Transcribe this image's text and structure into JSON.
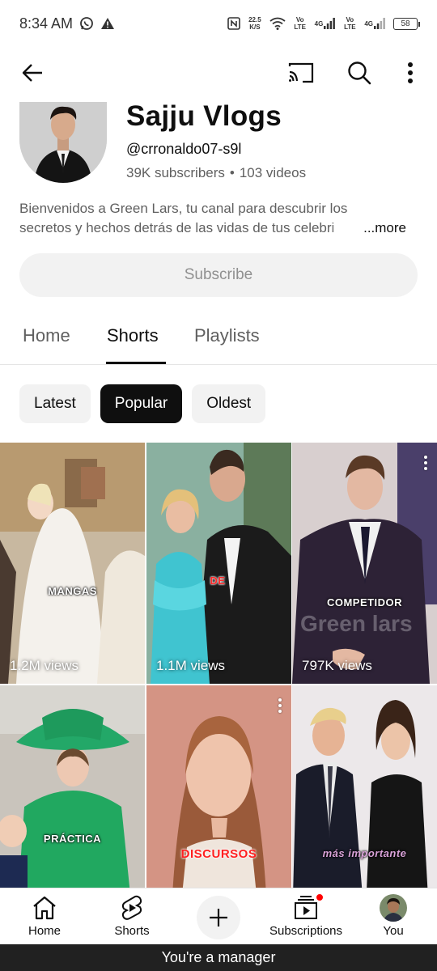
{
  "status_bar": {
    "time": "8:34 AM",
    "speed_value": "22.5",
    "speed_unit": "K/S",
    "network1": "Vo LTE",
    "network1_gen": "4G",
    "network2": "Vo LTE",
    "network2_gen": "4G",
    "battery": "58",
    "icons": [
      "whatsapp-icon",
      "warning-icon",
      "nfc-icon",
      "wifi-icon",
      "signal-icon",
      "battery-icon"
    ]
  },
  "topbar": {
    "icons": [
      "back-arrow-icon",
      "cast-icon",
      "search-icon",
      "more-vert-icon"
    ]
  },
  "channel": {
    "name": "Sajju Vlogs",
    "handle": "@crronaldo07-s9l",
    "subscribers": "39K subscribers",
    "separator": "•",
    "videos": "103 videos",
    "description_line1": "Bienvenidos a Green Lars, tu canal para descubrir los",
    "description_line2": "secretos y hechos detrás de las vidas de tus celebri",
    "more_label": "...more",
    "subscribe_label": "Subscribe"
  },
  "tabs": [
    {
      "label": "Home",
      "active": false
    },
    {
      "label": "Shorts",
      "active": true
    },
    {
      "label": "Playlists",
      "active": false
    }
  ],
  "chips": [
    {
      "label": "Latest",
      "active": false
    },
    {
      "label": "Popular",
      "active": true
    },
    {
      "label": "Oldest",
      "active": false
    }
  ],
  "shorts": [
    {
      "caption": "MANGAS",
      "views": "1.2M views"
    },
    {
      "caption": "DE",
      "views": "1.1M views"
    },
    {
      "caption": "COMPETIDOR",
      "watermark": "Green lars",
      "views": "797K views"
    },
    {
      "caption": "PRÁCTICA",
      "views": ""
    },
    {
      "caption": "DISCURSOS",
      "views": ""
    },
    {
      "caption": "más importante",
      "views": ""
    }
  ],
  "bottom_nav": {
    "items": [
      {
        "label": "Home",
        "icon": "home-icon"
      },
      {
        "label": "Shorts",
        "icon": "shorts-icon"
      },
      {
        "label": "",
        "icon": "plus-icon"
      },
      {
        "label": "Subscriptions",
        "icon": "subscriptions-icon"
      },
      {
        "label": "You",
        "icon": "avatar"
      }
    ]
  },
  "manager_banner": "You're a manager",
  "colors": {
    "accent": "#0f0f0f",
    "secondary_text": "#606060",
    "chip_bg": "#f2f2f2",
    "notification": "#ff0000"
  }
}
